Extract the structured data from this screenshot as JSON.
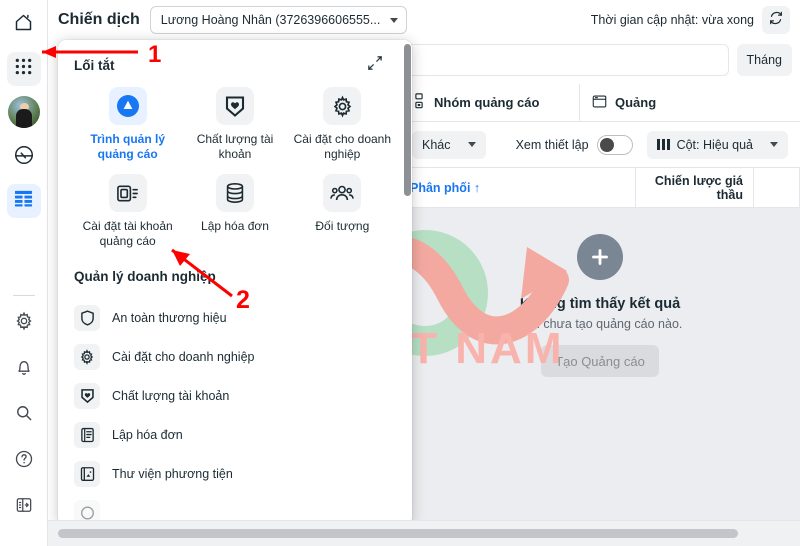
{
  "rail": {
    "items": [
      {
        "name": "home-icon",
        "label": "Trang chủ"
      },
      {
        "name": "apps-grid-icon",
        "label": "Tất cả công cụ"
      },
      {
        "name": "profile-avatar",
        "label": "Trang cá nhân"
      },
      {
        "name": "dashboard-icon",
        "label": "Bảng tin"
      },
      {
        "name": "table-icon",
        "label": "Trình quản lý quảng cáo"
      }
    ],
    "bottom_items": [
      {
        "name": "gear-icon",
        "label": "Cài đặt"
      },
      {
        "name": "bell-icon",
        "label": "Thông báo"
      },
      {
        "name": "search-icon",
        "label": "Tìm kiếm"
      },
      {
        "name": "help-icon",
        "label": "Trợ giúp"
      },
      {
        "name": "panel-toggle-icon",
        "label": "Thu gọn"
      }
    ]
  },
  "topbar": {
    "title": "Chiến dịch",
    "account_value": "Lương Hoàng Nhân (3726396606555...",
    "update_text": "Thời gian cập nhật: vừa xong",
    "refresh_icon": "refresh-icon"
  },
  "searchrow": {
    "search_placeholder": "",
    "search_value": "",
    "month_button": "Tháng"
  },
  "content": {
    "tabs": [
      {
        "label": "Nhóm quảng cáo",
        "icon": "adset-icon"
      },
      {
        "label": "Quảng",
        "icon": "ad-icon"
      }
    ],
    "toolbar": {
      "more_label": "Khác",
      "view_setup_label": "Xem thiết lập",
      "columns_label": "Cột: Hiệu quả"
    },
    "table_headers": [
      {
        "label": "Phân phối ↑",
        "type": "link"
      },
      {
        "label": "Chiến lược giá thầu",
        "type": "num"
      },
      {
        "label": "",
        "type": "num"
      }
    ],
    "empty_state": {
      "title": "Không tìm thấy kết quả",
      "subtitle": "Bạn chưa tạo quảng cáo nào.",
      "button": "Tạo Quảng cáo",
      "icon": "plus-circle-icon"
    }
  },
  "panel": {
    "shortcuts_title": "Lối tắt",
    "expand_icon": "expand-icon",
    "shortcuts": [
      {
        "label": "Trình quản lý quảng cáo",
        "icon": "ads-manager-icon",
        "active": true
      },
      {
        "label": "Chất lượng tài khoản",
        "icon": "shield-heart-icon",
        "active": false
      },
      {
        "label": "Cài đặt cho doanh nghiệp",
        "icon": "gear-icon",
        "active": false
      },
      {
        "label": "Cài đặt tài khoản quảng cáo",
        "icon": "ad-account-settings-icon",
        "active": false
      },
      {
        "label": "Lập hóa đơn",
        "icon": "billing-coins-icon",
        "active": false
      },
      {
        "label": "Đối tượng",
        "icon": "audience-people-icon",
        "active": false
      }
    ],
    "business_title": "Quản lý doanh nghiệp",
    "business_items": [
      {
        "label": "An toàn thương hiệu",
        "icon": "shield-icon"
      },
      {
        "label": "Cài đặt cho doanh nghiệp",
        "icon": "gear-icon"
      },
      {
        "label": "Chất lượng tài khoản",
        "icon": "shield-heart-icon"
      },
      {
        "label": "Lập hóa đơn",
        "icon": "billing-icon"
      },
      {
        "label": "Thư viện phương tiện",
        "icon": "media-library-icon"
      },
      {
        "label": "",
        "icon": "partial-item-icon"
      }
    ]
  },
  "annotations": [
    {
      "label": "1",
      "kind": "arrow-line-to-apps-grid"
    },
    {
      "label": "2",
      "kind": "arrow-to-ad-account-settings"
    }
  ],
  "watermark": {
    "brand": "moa",
    "text": "MOA VIỆT NAM",
    "green": "#b6dfc4",
    "pink": "#f4a9a0"
  },
  "colors": {
    "accent": "#1877f2",
    "annotation": "#ff0000",
    "panel_bg": "#ffffff",
    "empty_bg": "#ebedf0"
  }
}
